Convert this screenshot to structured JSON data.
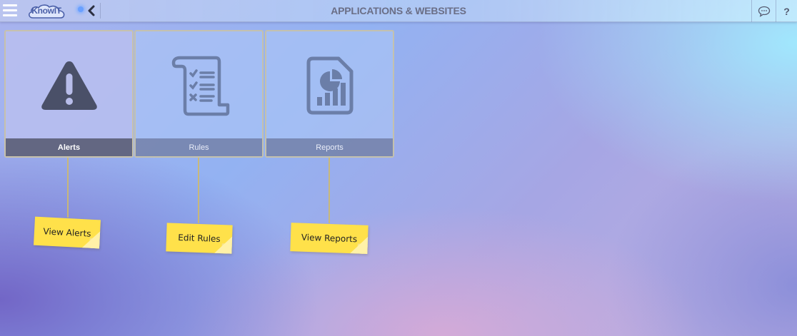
{
  "header": {
    "logo_text": "KnowIT",
    "title": "APPLICATIONS & WEBSITES",
    "help_label": "?",
    "icons": {
      "menu": "hamburger-menu-icon",
      "back": "chevron-left-icon",
      "chat": "chat-bubble-icon",
      "status": "status-dot-icon"
    }
  },
  "tiles": [
    {
      "label": "Alerts",
      "icon": "warning-triangle-icon",
      "active": true
    },
    {
      "label": "Rules",
      "icon": "checklist-scroll-icon",
      "active": false
    },
    {
      "label": "Reports",
      "icon": "report-chart-icon",
      "active": false
    }
  ],
  "notes": [
    {
      "label": "View Alerts"
    },
    {
      "label": "Edit Rules"
    },
    {
      "label": "View Reports"
    }
  ],
  "colors": {
    "note_yellow": "#ffe14a",
    "icon_dark": "#4a5068",
    "icon_muted": "#6b7ea8",
    "title_gray": "#6a6e86"
  }
}
